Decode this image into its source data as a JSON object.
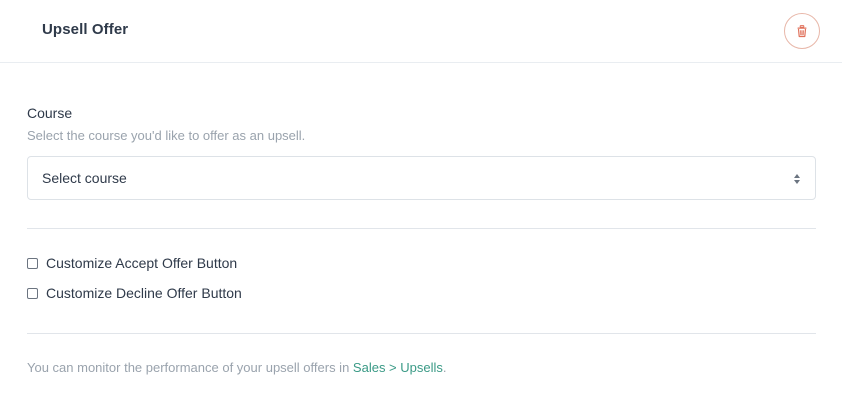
{
  "header": {
    "title": "Upsell Offer",
    "delete_icon": "trash-icon"
  },
  "course": {
    "label": "Course",
    "help": "Select the course you'd like to offer as an upsell.",
    "select_value": "Select course",
    "select_icon": "sort-arrows-icon"
  },
  "options": [
    {
      "label": "Customize Accept Offer Button",
      "checked": false
    },
    {
      "label": "Customize Decline Offer Button",
      "checked": false
    }
  ],
  "footer": {
    "text": "You can monitor the performance of your upsell offers in",
    "link": "Sales > Upsells",
    "suffix": "."
  },
  "colors": {
    "accent_link": "#3a9a86",
    "danger": "#e0705a",
    "text": "#2f3a4a",
    "muted": "#9aa3ad"
  }
}
